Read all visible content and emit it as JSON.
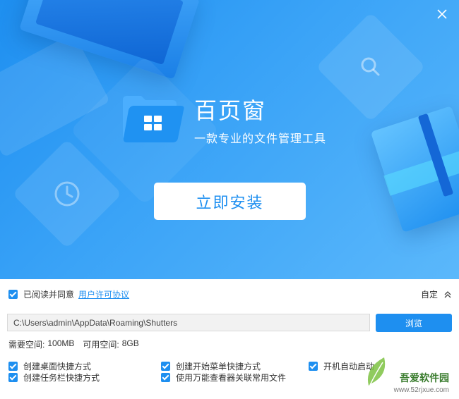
{
  "app": {
    "title": "百页窗",
    "subtitle": "一款专业的文件管理工具",
    "install_label": "立即安装"
  },
  "colors": {
    "accent": "#1e8ff0",
    "hero_start": "#1e8ff0",
    "hero_end": "#5bb8fb",
    "text": "#333333"
  },
  "icons": {
    "close": "close-icon",
    "logo": "folder-logo-icon",
    "search": "search-icon",
    "clock": "clock-icon",
    "chevron": "chevron-up-icon"
  },
  "agreement": {
    "checked": true,
    "text": "已阅读并同意",
    "link": "用户许可协议"
  },
  "custom": {
    "label": "自定"
  },
  "install_path": {
    "value": "C:\\Users\\admin\\AppData\\Roaming\\Shutters",
    "browse_label": "浏览"
  },
  "space": {
    "required_label": "需要空间:",
    "required_value": "100MB",
    "available_label": "可用空间:",
    "available_value": "8GB"
  },
  "options": [
    {
      "label": "创建桌面快捷方式",
      "checked": true
    },
    {
      "label": "创建开始菜单快捷方式",
      "checked": true
    },
    {
      "label": "开机自动启动",
      "checked": true
    },
    {
      "label": "创建任务栏快捷方式",
      "checked": true
    },
    {
      "label": "使用万能查看器关联常用文件",
      "checked": true
    }
  ],
  "watermark": {
    "text": "吾爱软件园",
    "url": "www.52rjxue.com"
  }
}
